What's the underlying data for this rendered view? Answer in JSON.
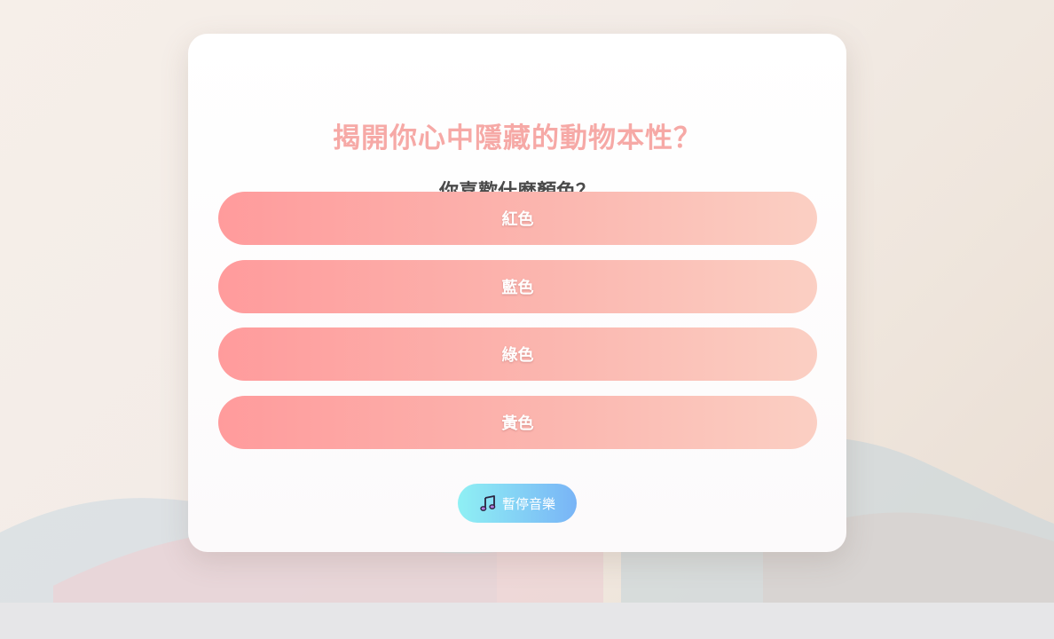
{
  "quiz": {
    "title": "揭開你心中隱藏的動物本性？",
    "question": "你喜歡什麼顏色？",
    "options": [
      {
        "label": "紅色"
      },
      {
        "label": "藍色"
      },
      {
        "label": "綠色"
      },
      {
        "label": "黃色"
      }
    ]
  },
  "music": {
    "icon": "music-note-icon",
    "label": "暫停音樂"
  },
  "colors": {
    "title": "#f6a9a6",
    "question": "#4a4a4a",
    "option_gradient_start": "#ff9b9c",
    "option_gradient_end": "#fbcfc3",
    "music_gradient_start": "#8ff0f4",
    "music_gradient_end": "#79b4f6"
  }
}
